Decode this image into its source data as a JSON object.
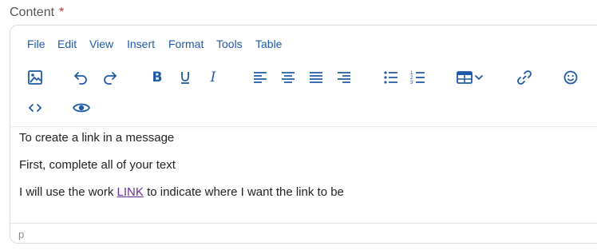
{
  "field": {
    "label": "Content",
    "required_mark": "*"
  },
  "menubar": {
    "items": [
      "File",
      "Edit",
      "View",
      "Insert",
      "Format",
      "Tools",
      "Table"
    ]
  },
  "toolbar": {
    "icons": [
      "image-icon",
      "undo-icon",
      "redo-icon",
      "bold-icon",
      "underline-icon",
      "italic-icon",
      "align-left-icon",
      "align-center-icon",
      "align-justify-icon",
      "align-right-icon",
      "bullet-list-icon",
      "numbered-list-icon",
      "table-icon",
      "link-icon",
      "emoji-icon",
      "code-icon",
      "preview-icon"
    ],
    "bold_glyph": "B",
    "underline_glyph": "U",
    "italic_glyph": "I",
    "accent_color": "#1f5aa8"
  },
  "content": {
    "line1": "To create a link in a message",
    "line2": "First, complete all of your text",
    "line3_before": "I will use the work ",
    "line3_link": "LINK",
    "line3_after": " to indicate where I want the link to be",
    "link_color": "#6a2f95"
  },
  "statusbar": {
    "path": "p"
  }
}
